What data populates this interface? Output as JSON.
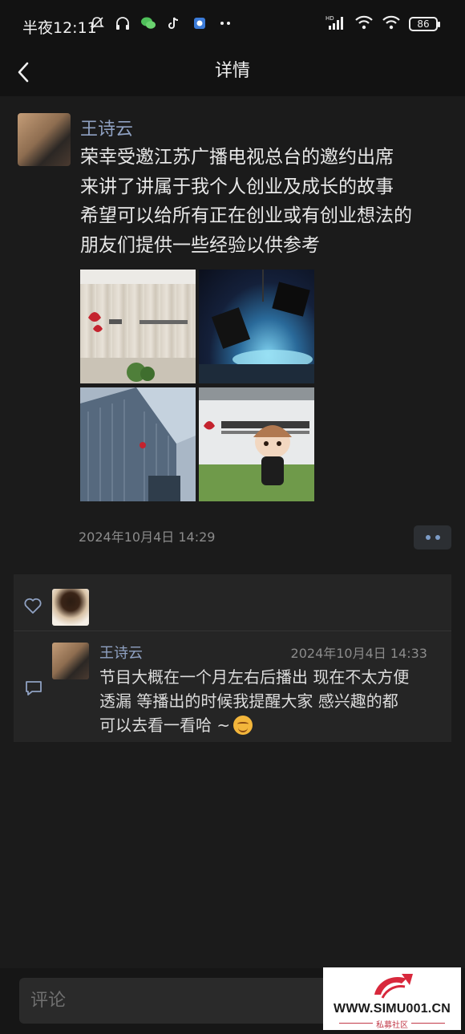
{
  "status_bar": {
    "time": "半夜12:11",
    "battery": "86",
    "icons_left": [
      "mute-bell-icon",
      "headphones-icon",
      "wechat-icon",
      "tiktok-icon",
      "app-icon",
      "more-dots-icon"
    ],
    "icons_right": [
      "hd-signal-icon",
      "wifi-icon",
      "wifi-6-icon",
      "battery-icon"
    ]
  },
  "header": {
    "title": "详情"
  },
  "post": {
    "author": "王诗云",
    "lines": [
      "荣幸受邀江苏广播电视总台的邀约出席",
      "来讲了讲属于我个人创业及成长的故事",
      "希望可以给所有正在创业或有创业想法的",
      "朋友们提供一些经验以供参考"
    ],
    "photos": [
      "building-logo-wall-photo",
      "tv-studio-photo",
      "skyscraper-photo",
      "corporation-sign-photo"
    ],
    "time": "2024年10月4日 14:29"
  },
  "comment": {
    "author": "王诗云",
    "time": "2024年10月4日 14:33",
    "lines": [
      "节目大概在一个月左右后播出 现在不太方便",
      "透漏 等播出的时候我提醒大家 感兴趣的都",
      "可以去看一看哈 ~"
    ]
  },
  "input": {
    "placeholder": "评论"
  },
  "watermark": {
    "text": "WWW.SIMU001.CN",
    "sub": "私募社区"
  },
  "colors": {
    "background": "#1b1b1b",
    "name_link": "#8fa1c2",
    "panel": "#252525"
  }
}
